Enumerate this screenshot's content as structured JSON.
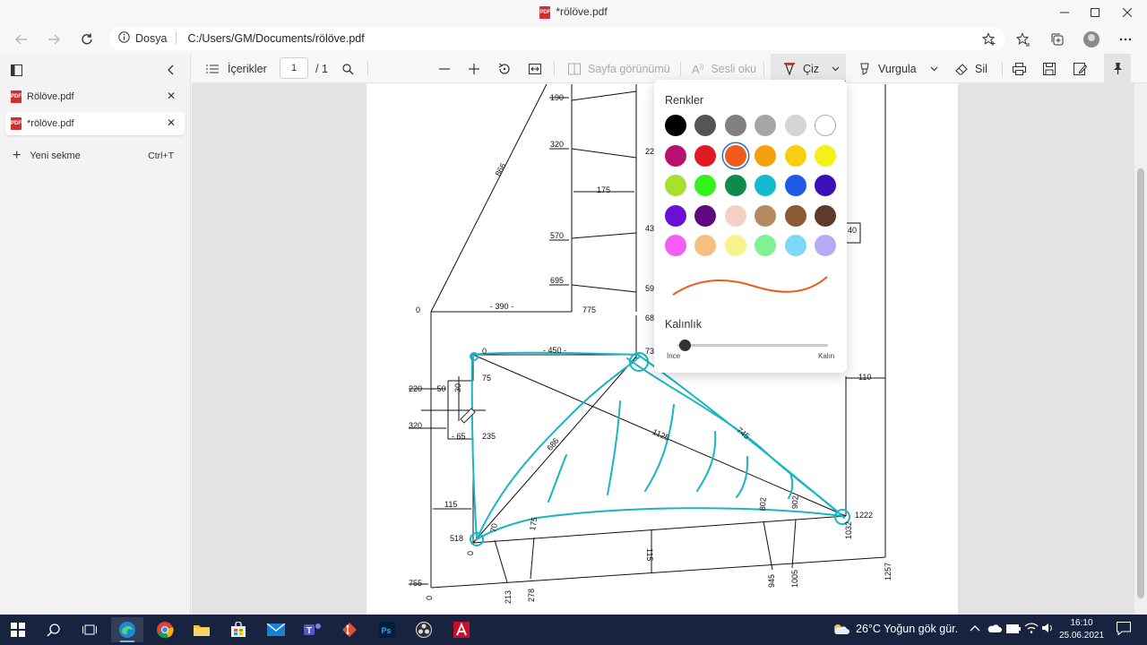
{
  "window": {
    "title": "*rölöve.pdf",
    "minimize_icon": "minimize-icon",
    "maximize_icon": "maximize-icon",
    "close_icon": "close-icon"
  },
  "address_bar": {
    "site_label": "Dosya",
    "url": "C:/Users/GM/Documents/rölöve.pdf"
  },
  "sidebar": {
    "tabs": [
      {
        "label": "Rölöve.pdf",
        "active": false
      },
      {
        "label": "*rölöve.pdf",
        "active": true
      }
    ],
    "new_tab_label": "Yeni sekme",
    "new_tab_shortcut": "Ctrl+T"
  },
  "pdf_toolbar": {
    "contents_label": "İçerikler",
    "page_number": "1",
    "page_total": "/ 1",
    "page_view_label": "Sayfa görünümü",
    "read_aloud_label": "Sesli oku",
    "draw_label": "Çiz",
    "highlight_label": "Vurgula",
    "erase_label": "Sil"
  },
  "draw_panel": {
    "colors_title": "Renkler",
    "colors": [
      [
        "#000000",
        "#555555",
        "#808080",
        "#a6a6a6",
        "#d4d4d4",
        "#ffffff"
      ],
      [
        "#b8106e",
        "#e01a24",
        "#f05a1a",
        "#f4a10e",
        "#f7cf10",
        "#f4f01a"
      ],
      [
        "#a8e02e",
        "#36f21c",
        "#0f8a4a",
        "#12bccc",
        "#1e5be6",
        "#3b10b8"
      ],
      [
        "#6a10d6",
        "#5e0a7e",
        "#f2d2c4",
        "#b48a62",
        "#8c5a34",
        "#5e3a2c"
      ],
      [
        "#f45ef4",
        "#f8c080",
        "#f8f48c",
        "#80f294",
        "#80d8f8",
        "#b4aaf8"
      ]
    ],
    "selected_color": "#f05a1a",
    "thickness_title": "Kalınlık",
    "thickness_min": "İnce",
    "thickness_max": "Kalın",
    "thickness_value": 0.05
  },
  "document": {
    "labels": {
      "l190": "190",
      "l320a": "320",
      "l175": "175",
      "l570": "570",
      "l695": "695",
      "l866": "866",
      "l390": "- 390 -",
      "l775": "775",
      "l0a": "0",
      "l22": "22",
      "l43": "43",
      "l59": "59",
      "l68": "68",
      "l40": "40",
      "l0b": "0",
      "l450": "- 450 -",
      "l73": "73",
      "l75": "75",
      "l220": "220",
      "l50": "- 50",
      "l30": "30",
      "l320b": "320",
      "l65": "- 65",
      "l235": "235",
      "l110": "110",
      "l686": "686",
      "l1125": "1125",
      "l745": "745",
      "l115": "115",
      "l518": "518",
      "l70": "70",
      "l175b": "175",
      "l802": "802",
      "l902": "902",
      "l1222": "1222",
      "l1032": "1032",
      "l115b": "115",
      "l755": "755",
      "l0c": "0",
      "l213": "213",
      "l278": "278",
      "l945": "945",
      "l1005": "1005",
      "l1257": "1257",
      "l0d": "0"
    }
  },
  "taskbar": {
    "weather": "26°C  Yoğun gök gür.",
    "time": "16:10",
    "date": "25.06.2021",
    "apps": [
      "start",
      "search",
      "task-view",
      "edge",
      "chrome",
      "file-explorer",
      "store",
      "mail",
      "teams",
      "git",
      "photoshop",
      "obs",
      "autocad"
    ]
  }
}
